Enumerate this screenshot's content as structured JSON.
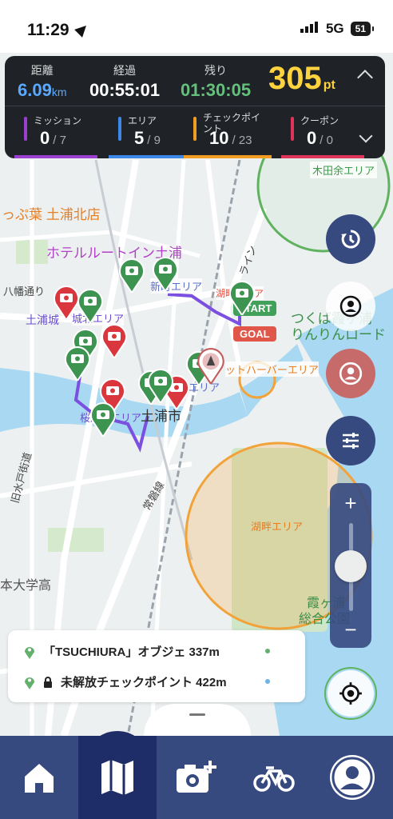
{
  "status": {
    "time": "11:29",
    "network": "5G",
    "battery": "51"
  },
  "hud": {
    "distance_label": "距離",
    "distance_value": "6.09",
    "distance_unit": "km",
    "elapsed_label": "経過",
    "elapsed_value": "00:55:01",
    "remaining_label": "残り",
    "remaining_value": "01:30:05",
    "points_value": "305",
    "points_unit": "pt",
    "stats": [
      {
        "label": "ミッション",
        "value": "0",
        "total": "/ 7",
        "color": "#9b3fd1"
      },
      {
        "label": "エリア",
        "value": "5",
        "total": "/ 9",
        "color": "#3b88e8"
      },
      {
        "label": "チェックポイ ント",
        "value": "10",
        "total": "/ 23",
        "color": "#f39c23"
      },
      {
        "label": "クーポン",
        "value": "0",
        "total": "/ 0",
        "color": "#e0335a"
      }
    ]
  },
  "map": {
    "labels": [
      {
        "text": "木田余エリア",
        "color": "#3c9a4a",
        "key": "kidamari"
      },
      {
        "text": "っぷ葉 土浦北店",
        "color": "#e67e22",
        "key": "happa"
      },
      {
        "text": "ホテルルートイン土浦",
        "color": "#b142c6",
        "key": "hotel"
      },
      {
        "text": "八幡通り",
        "color": "#444",
        "key": "hachiman"
      },
      {
        "text": "新町エリア",
        "color": "#5a6fc9",
        "key": "shinmachi"
      },
      {
        "text": "湖畔エリア",
        "color": "#e74c3c",
        "key": "kohan1"
      },
      {
        "text": "土浦城",
        "color": "#6a4fcf",
        "key": "tsuchiurajo"
      },
      {
        "text": "城北エリア",
        "color": "#6a4fcf",
        "key": "johoku"
      },
      {
        "text": "START",
        "color": "#fff",
        "key": "start"
      },
      {
        "text": "GOAL",
        "color": "#fff",
        "key": "goal"
      },
      {
        "text": "つくば霞ヶ浦",
        "color": "#3b8e4a",
        "key": "tsukuba1"
      },
      {
        "text": "りんりんロード",
        "color": "#3b8e4a",
        "key": "tsukuba2"
      },
      {
        "text": "ットハーバーエリア",
        "color": "#e67e22",
        "key": "harbor"
      },
      {
        "text": "エリア",
        "color": "#5a6fc9",
        "key": "area2"
      },
      {
        "text": "桜川",
        "color": "#6a4fcf",
        "key": "sakura"
      },
      {
        "text": "エリア",
        "color": "#6a4fcf",
        "key": "area3"
      },
      {
        "text": "土浦市",
        "color": "#333",
        "key": "city"
      },
      {
        "text": "旧水戸街道",
        "color": "#444",
        "key": "mito"
      },
      {
        "text": "常磐線",
        "color": "#444",
        "key": "joban"
      },
      {
        "text": "湖畔エリア",
        "color": "#e67e22",
        "key": "kohan2"
      },
      {
        "text": "本大学高",
        "color": "#555",
        "key": "school"
      },
      {
        "text": "霞ヶ浦",
        "color": "#3b8e4a",
        "key": "kasumi1"
      },
      {
        "text": "総合公園",
        "color": "#3b8e4a",
        "key": "kasumi2"
      },
      {
        "text": "ライン",
        "color": "#444",
        "key": "line"
      }
    ]
  },
  "info": {
    "rows": [
      {
        "text": "「TSUCHIURA」オブジェ 337m"
      },
      {
        "text": "未解放チェックポイント 422m"
      }
    ]
  },
  "zoom": {
    "plus": "+",
    "minus": "−"
  },
  "icons": [
    "navigation-arrow-icon",
    "signal-icon",
    "history-icon",
    "user-location-icon",
    "profile-icon",
    "filter-icon",
    "gps-target-icon",
    "home-icon",
    "map-icon",
    "camera-add-icon",
    "bicycle-icon",
    "account-icon",
    "lock-icon",
    "pin-icon"
  ]
}
